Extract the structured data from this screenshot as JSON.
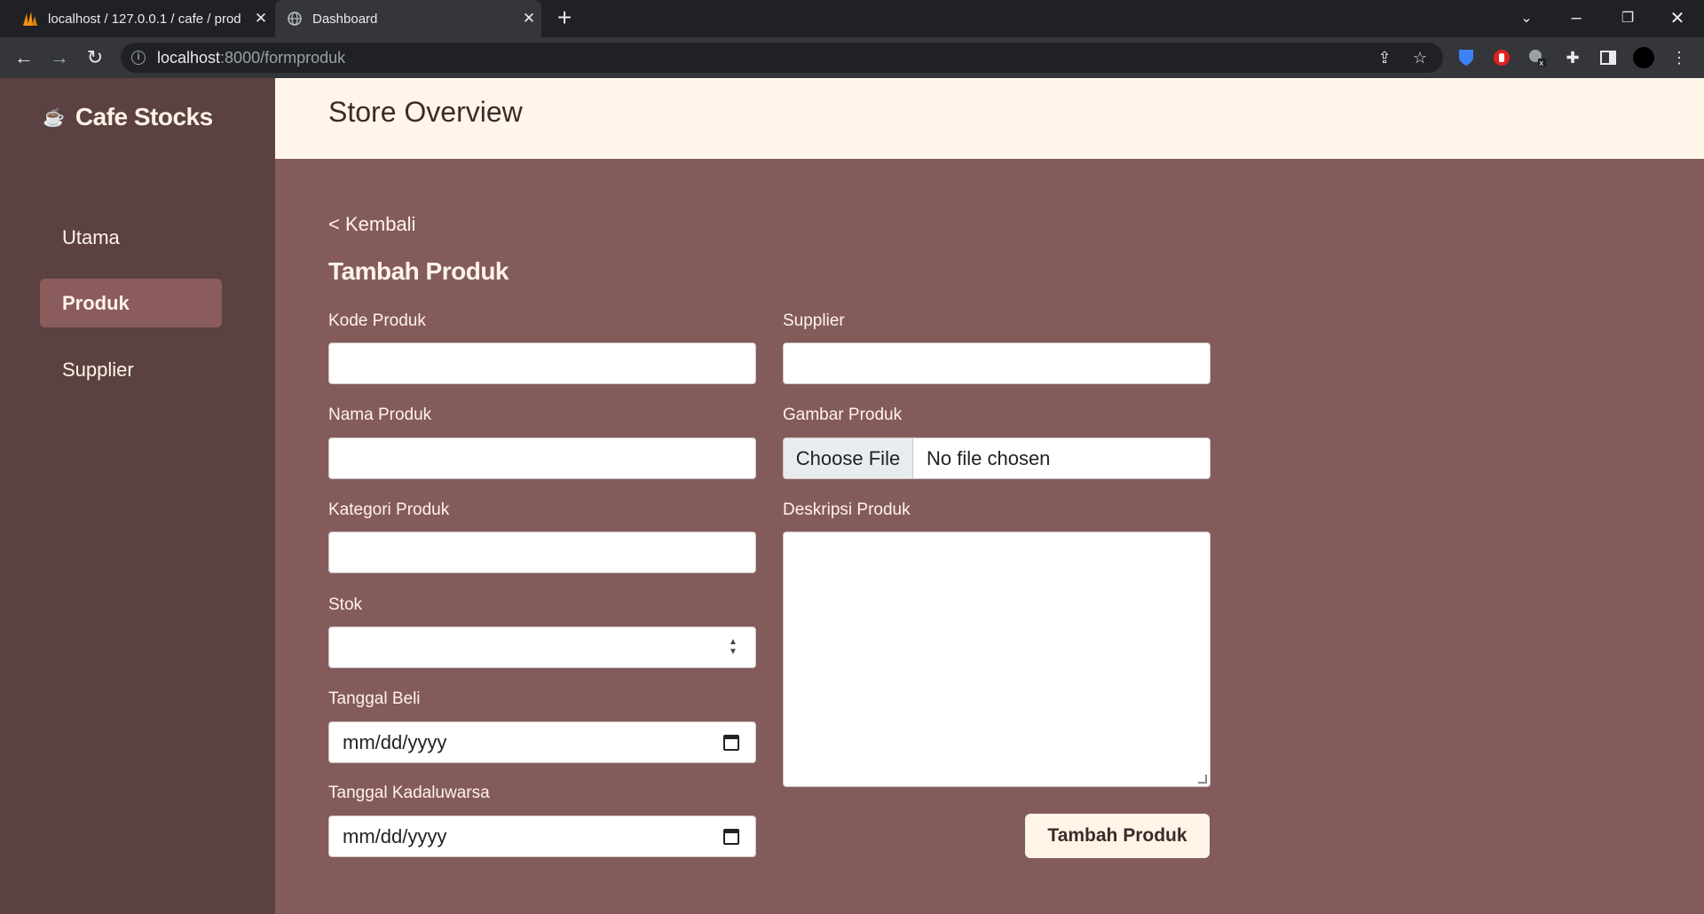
{
  "browser": {
    "tabs": [
      {
        "title": "localhost / 127.0.0.1 / cafe / prod",
        "icon": "phpmyadmin-icon",
        "active": false
      },
      {
        "title": "Dashboard",
        "icon": "globe-icon",
        "active": true
      }
    ],
    "url_host": "localhost",
    "url_path": ":8000/formproduk"
  },
  "sidebar": {
    "brand_icon": "☕",
    "brand": "Cafe Stocks",
    "items": [
      {
        "label": "Utama",
        "active": false
      },
      {
        "label": "Produk",
        "active": true
      },
      {
        "label": "Supplier",
        "active": false
      }
    ]
  },
  "header": {
    "title": "Store Overview"
  },
  "form": {
    "back_label": "< Kembali",
    "title": "Tambah Produk",
    "kode_label": "Kode Produk",
    "nama_label": "Nama Produk",
    "kategori_label": "Kategori Produk",
    "stok_label": "Stok",
    "tgl_beli_label": "Tanggal Beli",
    "tgl_beli_placeholder": "mm/dd/yyyy",
    "tgl_kadaluwarsa_label": "Tanggal Kadaluwarsa",
    "tgl_kadaluwarsa_placeholder": "mm/dd/yyyy",
    "supplier_label": "Supplier",
    "gambar_label": "Gambar Produk",
    "file_button": "Choose File",
    "file_status": "No file chosen",
    "deskripsi_label": "Deskripsi Produk",
    "submit_label": "Tambah Produk"
  },
  "colors": {
    "sidebar_bg": "#5b4141",
    "main_bg": "#845b5b",
    "header_bg": "#fff6e9",
    "accent_cream": "#fff4e6",
    "active_nav": "#8a5c5c"
  }
}
